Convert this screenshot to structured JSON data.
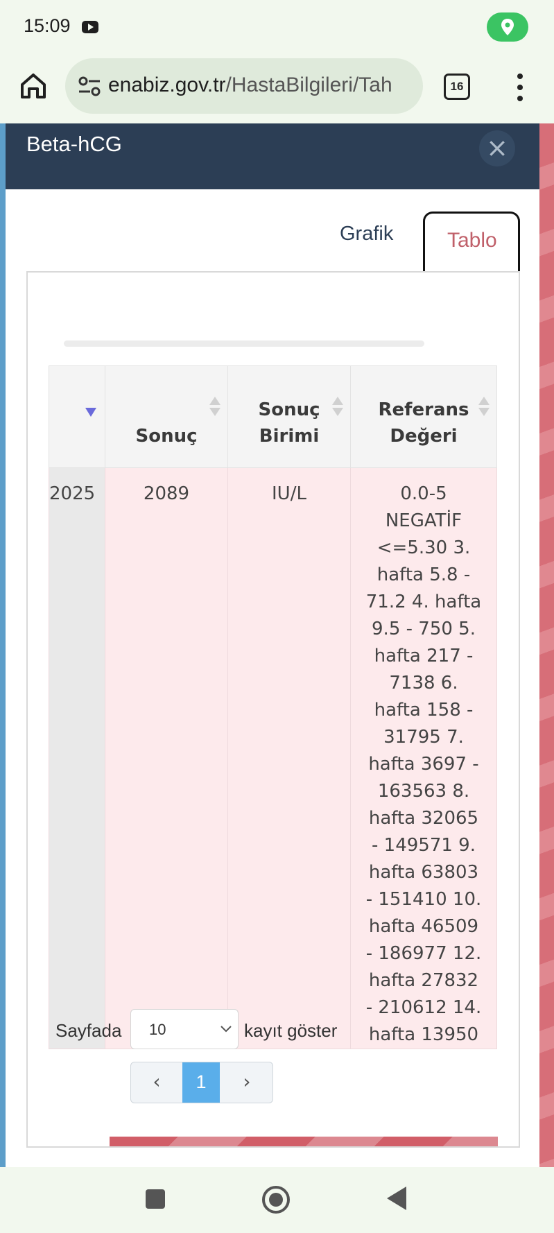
{
  "status_bar": {
    "time": "15:09"
  },
  "browser": {
    "url_domain": "enabiz.gov.tr",
    "url_path": "/HastaBilgileri/Tah",
    "tab_count": "16"
  },
  "modal": {
    "title": "Beta-hCG",
    "close_label": "×",
    "tabs": [
      {
        "label": "Grafik",
        "active": false
      },
      {
        "label": "Tablo",
        "active": true
      }
    ]
  },
  "table": {
    "columns": [
      "Sonuç",
      "Sonuç Birimi",
      "Referans Değeri"
    ],
    "column_lines": {
      "sonuc": [
        "Sonuç"
      ],
      "birim": [
        "Sonuç",
        "Birimi"
      ],
      "ref": [
        "Referans",
        "Değeri"
      ]
    },
    "rows": [
      {
        "date_partial": "2025",
        "sonuc": "2089",
        "birim": "IU/L",
        "referans": "0.0-5 NEGATİF <=5.30 3. hafta 5.8 - 71.2 4. hafta 9.5 - 750 5. hafta 217 - 7138 6. hafta 158 - 31795 7. hafta 3697 - 163563 8. hafta 32065 - 149571 9. hafta 63803 - 151410 10. hafta 46509 - 186977 12. hafta 27832 - 210612 14. hafta 13950"
      }
    ]
  },
  "length_menu": {
    "prefix": "Sayfada",
    "value": "10",
    "suffix": "kayıt göster"
  },
  "pagination": {
    "prev": "‹",
    "current": "1",
    "next": "›"
  },
  "colors": {
    "header_bg": "#2c3e55",
    "active_tab_text": "#c0606a",
    "row_highlight": "#fdeaec",
    "page_active": "#5aaeea"
  }
}
